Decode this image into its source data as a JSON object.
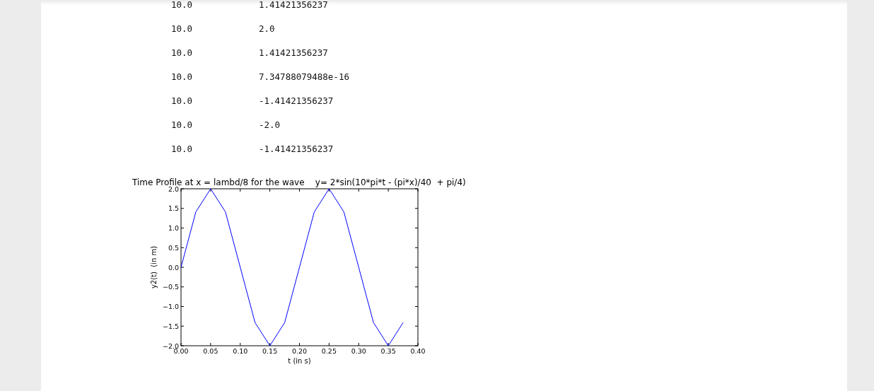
{
  "rows": [
    {
      "column_1": "10.0",
      "column_2": "1.41421356237"
    },
    {
      "column_1": "10.0",
      "column_2": "2.0"
    },
    {
      "column_1": "10.0",
      "column_2": "1.41421356237"
    },
    {
      "column_1": "10.0",
      "column_2": "7.34788079488e-16"
    },
    {
      "column_1": "10.0",
      "column_2": "-1.41421356237"
    },
    {
      "column_1": "10.0",
      "column_2": "-2.0"
    },
    {
      "column_1": "10.0",
      "column_2": "-1.41421356237"
    }
  ],
  "chart": {
    "chart_data": {
      "type": "line",
      "title": "Time Profile at x = lambd/8 for the wave    y= 2*sin(10*pi*t - (pi*x)/40  + pi/4)",
      "xlabel": "t (in s)",
      "ylabel": "y2(t)  (in m)",
      "x": [
        0,
        0.025,
        0.05,
        0.075,
        0.1,
        0.125,
        0.15,
        0.175,
        0.2,
        0.225,
        0.25,
        0.275,
        0.3,
        0.325,
        0.35,
        0.375
      ],
      "series": [
        {
          "color": "#0000ff",
          "values": [
            0,
            1.41,
            2,
            1.41,
            0,
            -1.41,
            -2,
            -1.41,
            0,
            1.41,
            2,
            1.41,
            0,
            -1.41,
            -2,
            -1.41
          ]
        }
      ],
      "xlim": [
        0,
        0.4
      ],
      "ylim": [
        -2,
        2
      ],
      "xticks": [
        {
          "value": 0,
          "label": "0.00"
        },
        {
          "value": 0.05,
          "label": "0.05"
        },
        {
          "value": 0.1,
          "label": "0.10"
        },
        {
          "value": 0.15,
          "label": "0.15"
        },
        {
          "value": 0.2,
          "label": "0.20"
        },
        {
          "value": 0.25,
          "label": "0.25"
        },
        {
          "value": 0.3,
          "label": "0.30"
        },
        {
          "value": 0.35,
          "label": "0.35"
        },
        {
          "value": 0.4,
          "label": "0.40"
        }
      ],
      "yticks": [
        {
          "value": -2,
          "label": "−2.0"
        },
        {
          "value": -1.5,
          "label": "−1.5"
        },
        {
          "value": -1,
          "label": "−1.0"
        },
        {
          "value": -0.5,
          "label": "−0.5"
        },
        {
          "value": 0,
          "label": "0.0"
        },
        {
          "value": 0.5,
          "label": "0.5"
        },
        {
          "value": 1,
          "label": "1.0"
        },
        {
          "value": 1.5,
          "label": "1.5"
        },
        {
          "value": 2,
          "label": "2.0"
        }
      ]
    }
  }
}
